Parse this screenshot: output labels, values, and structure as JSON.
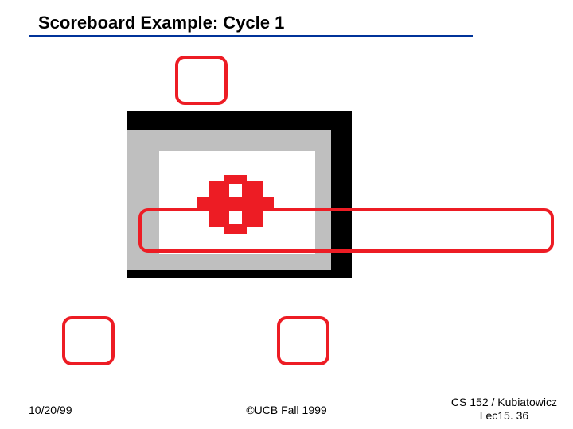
{
  "title": "Scoreboard Example: Cycle 1",
  "footer": {
    "left": "10/20/99",
    "center": "©UCB Fall 1999",
    "right": "CS 152 / Kubiatowicz\nLec15. 36"
  }
}
